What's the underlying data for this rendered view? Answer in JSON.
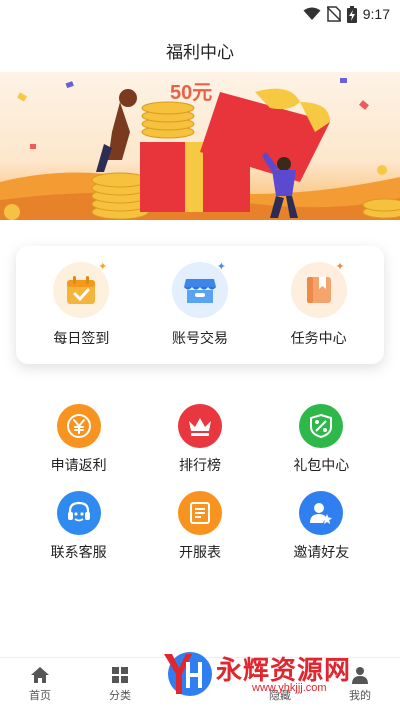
{
  "status_bar": {
    "time": "9:17"
  },
  "header": {
    "title": "福利中心"
  },
  "banner": {
    "text": "50元"
  },
  "quick_actions": [
    {
      "label": "每日签到",
      "icon": "calendar-check-icon"
    },
    {
      "label": "账号交易",
      "icon": "shop-icon"
    },
    {
      "label": "任务中心",
      "icon": "bookmark-book-icon"
    }
  ],
  "grid": [
    {
      "label": "申请返利",
      "icon": "yuan-coin-icon",
      "color": "#f7931e"
    },
    {
      "label": "排行榜",
      "icon": "crown-icon",
      "color": "#e8373f"
    },
    {
      "label": "礼包中心",
      "icon": "coupon-percent-icon",
      "color": "#2fb84a"
    },
    {
      "label": "联系客服",
      "icon": "headset-icon",
      "color": "#2f8bf0"
    },
    {
      "label": "开服表",
      "icon": "list-icon",
      "color": "#f7931e"
    },
    {
      "label": "邀请好友",
      "icon": "user-star-icon",
      "color": "#2f7ff0"
    }
  ],
  "tab_bar": {
    "home": "首页",
    "category": "分类",
    "partial3": "隐藏",
    "mine": "我的"
  },
  "watermark": {
    "text": "永辉资源网",
    "url": "www.yhkjjj.com"
  }
}
